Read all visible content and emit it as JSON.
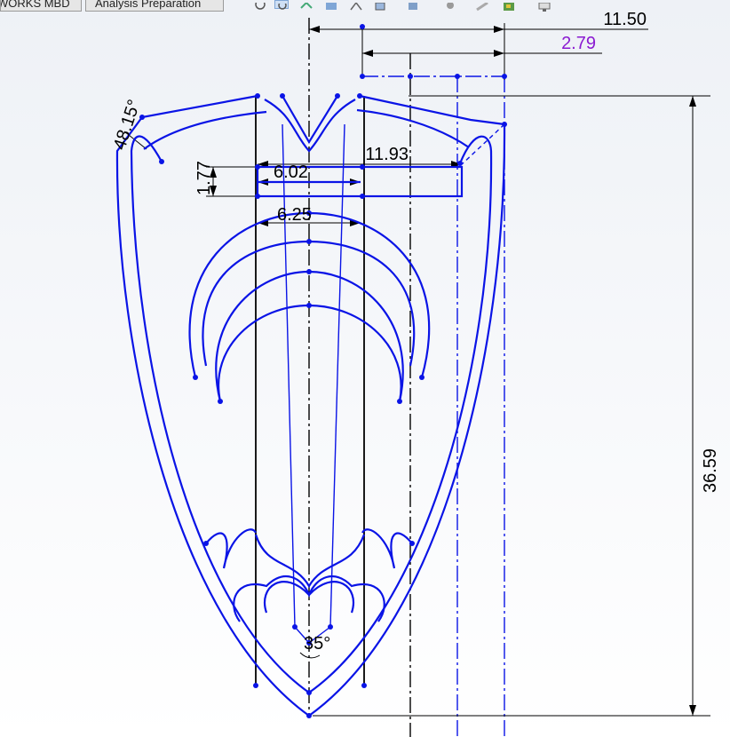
{
  "tabs": [
    {
      "label": "WORKS MBD",
      "active": false
    },
    {
      "label": "Analysis Preparation",
      "active": false
    }
  ],
  "toolbar": {
    "icons": [
      "zoom-to-fit-icon",
      "zoom-area-icon",
      "previous-view-icon",
      "section-view-icon",
      "dynamic-annotation-icon",
      "view-orientation-icon",
      "display-style-icon",
      "hide-show-icon",
      "edit-appearance-icon",
      "apply-scene-icon",
      "view-settings-icon"
    ]
  },
  "colors": {
    "sketch": "#0a14e6",
    "dimension": "#000000",
    "driven_dimension": "#8a1ad1",
    "construction": "#0a14e6",
    "background_top": "#eef1f6"
  },
  "dimensions": {
    "top_width": "11.50",
    "offset": "2.79",
    "slot_length": "11.93",
    "inner_width_a": "6.02",
    "slot_height": "1.77",
    "inner_width_b": "6.25",
    "overall_height": "36.59",
    "angle_top": "48.15°",
    "angle_bottom": "35°"
  }
}
